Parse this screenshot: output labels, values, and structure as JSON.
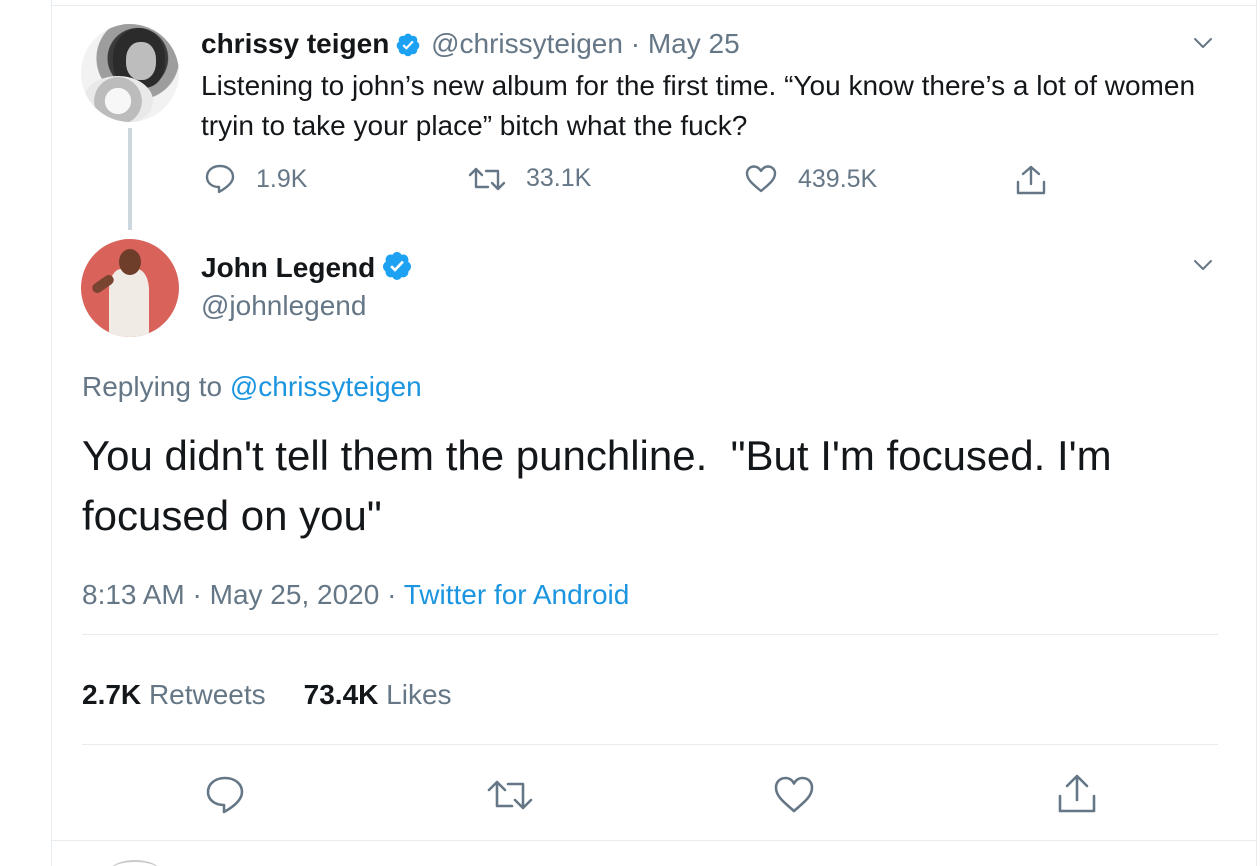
{
  "original_tweet": {
    "author_name": "chrissy teigen",
    "author_handle": "@chrissyteigen",
    "separator": "·",
    "date": "May 25",
    "text": "Listening to john’s new album for the first time. “You know there’s a lot of women tryin to take your place” bitch what the fuck?",
    "reply_count": "1.9K",
    "retweet_count": "33.1K",
    "like_count": "439.5K"
  },
  "reply_tweet": {
    "author_name": "John Legend",
    "author_handle": "@johnlegend",
    "replying_prefix": "Replying to ",
    "replying_to": "@chrissyteigen",
    "text": "You didn't tell them the punchline.  \"But I'm focused. I'm focused on you\"",
    "time": "8:13 AM",
    "date": "May 25, 2020",
    "separator": "·",
    "source": "Twitter for Android",
    "retweets_count": "2.7K",
    "retweets_label": "Retweets",
    "likes_count": "73.4K",
    "likes_label": "Likes"
  },
  "colors": {
    "text_primary": "#14171a",
    "text_muted": "#657786",
    "link": "#1b95e0",
    "verified": "#1da1f2",
    "border": "#e6ecf0"
  },
  "icons": {
    "verified": "verified-badge-icon",
    "caret": "chevron-down-icon",
    "reply": "reply-icon",
    "retweet": "retweet-icon",
    "like": "heart-icon",
    "share": "share-icon"
  }
}
